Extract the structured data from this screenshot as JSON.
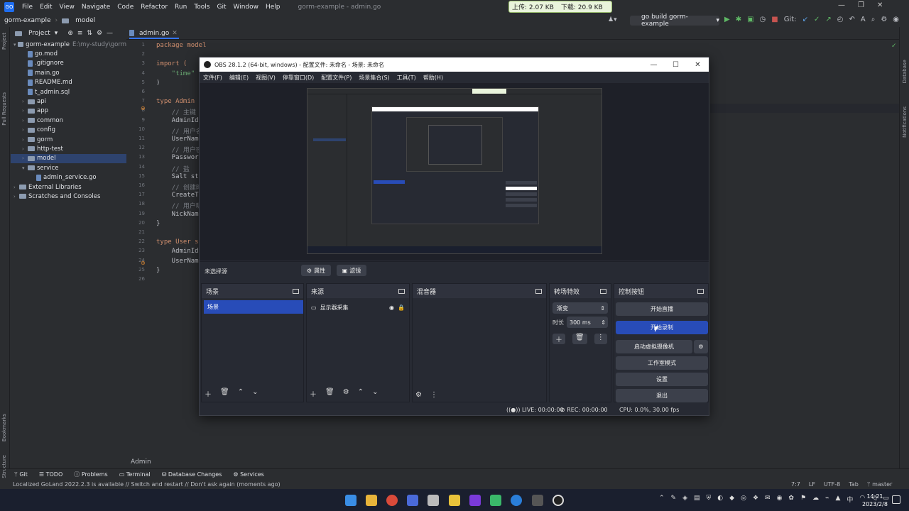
{
  "ide": {
    "menu": [
      "File",
      "Edit",
      "View",
      "Navigate",
      "Code",
      "Refactor",
      "Run",
      "Tools",
      "Git",
      "Window",
      "Help"
    ],
    "window_title": "gorm-example - admin.go",
    "breadcrumb": [
      "gorm-example",
      "model"
    ],
    "run_config": "go build gorm-example",
    "net_widget": {
      "up": "上传: 2.07 KB",
      "down": "下载: 20.9 KB"
    },
    "project_label": "Project",
    "tree": [
      {
        "label": "gorm-example",
        "suffix": "E:\\my-study\\gorm",
        "kind": "folder",
        "indent": 0,
        "open": true
      },
      {
        "label": "go.mod",
        "kind": "file",
        "indent": 1
      },
      {
        "label": ".gitignore",
        "kind": "file",
        "indent": 1
      },
      {
        "label": "main.go",
        "kind": "file",
        "indent": 1
      },
      {
        "label": "README.md",
        "kind": "file",
        "indent": 1
      },
      {
        "label": "t_admin.sql",
        "kind": "file",
        "indent": 1
      },
      {
        "label": "api",
        "kind": "folder",
        "indent": 1
      },
      {
        "label": "app",
        "kind": "folder",
        "indent": 1
      },
      {
        "label": "common",
        "kind": "folder",
        "indent": 1
      },
      {
        "label": "config",
        "kind": "folder",
        "indent": 1
      },
      {
        "label": "gorm",
        "kind": "folder",
        "indent": 1
      },
      {
        "label": "http-test",
        "kind": "folder",
        "indent": 1
      },
      {
        "label": "model",
        "kind": "folder",
        "indent": 1,
        "selected": true
      },
      {
        "label": "service",
        "kind": "folder",
        "indent": 1,
        "open": true
      },
      {
        "label": "admin_service.go",
        "kind": "file",
        "indent": 2
      },
      {
        "label": "External Libraries",
        "kind": "folder",
        "indent": 0
      },
      {
        "label": "Scratches and Consoles",
        "kind": "folder",
        "indent": 0
      }
    ],
    "editor_tab": "admin.go",
    "code_lines": [
      {
        "n": "1",
        "t": "package model",
        "c": "kw"
      },
      {
        "n": "2",
        "t": "",
        "c": ""
      },
      {
        "n": "3",
        "t": "import (",
        "c": "kw"
      },
      {
        "n": "4",
        "t": "    \"time\"",
        "c": "str"
      },
      {
        "n": "5",
        "t": ")",
        "c": ""
      },
      {
        "n": "6",
        "t": "",
        "c": ""
      },
      {
        "n": "7",
        "t": "type Admin",
        "c": "kw"
      },
      {
        "n": "8",
        "t": "    // 主键",
        "c": "cm"
      },
      {
        "n": "9",
        "t": "    AdminId",
        "c": ""
      },
      {
        "n": "10",
        "t": "    // 用户名",
        "c": "cm"
      },
      {
        "n": "11",
        "t": "    UserNam",
        "c": ""
      },
      {
        "n": "12",
        "t": "    // 用户密",
        "c": "cm"
      },
      {
        "n": "13",
        "t": "    Passwor",
        "c": ""
      },
      {
        "n": "14",
        "t": "    // 盐",
        "c": "cm"
      },
      {
        "n": "15",
        "t": "    Salt st",
        "c": ""
      },
      {
        "n": "16",
        "t": "    // 创建时",
        "c": "cm"
      },
      {
        "n": "17",
        "t": "    CreateT",
        "c": ""
      },
      {
        "n": "18",
        "t": "    // 用户昵",
        "c": "cm"
      },
      {
        "n": "19",
        "t": "    NickNam",
        "c": ""
      },
      {
        "n": "20",
        "t": "}",
        "c": ""
      },
      {
        "n": "21",
        "t": "",
        "c": ""
      },
      {
        "n": "22",
        "t": "type User s",
        "c": "kw"
      },
      {
        "n": "23",
        "t": "    AdminId",
        "c": ""
      },
      {
        "n": "24",
        "t": "    UserNam",
        "c": ""
      },
      {
        "n": "25",
        "t": "}",
        "c": ""
      },
      {
        "n": "26",
        "t": "",
        "c": ""
      }
    ],
    "editor_footer": "Admin",
    "bottom_tools": [
      "Git",
      "TODO",
      "Problems",
      "Terminal",
      "Database Changes",
      "Services"
    ],
    "status_message": "Localized GoLand 2022.2.3 is available // Switch and restart // Don't ask again (moments ago)",
    "status_right": [
      "7:7",
      "LF",
      "UTF-8",
      "Tab",
      "master"
    ],
    "left_vtabs": [
      "Project",
      "Pull Requests",
      "Bookmarks",
      "Structure"
    ],
    "right_vtabs": [
      "Database",
      "Notifications"
    ]
  },
  "obs": {
    "title": "OBS 28.1.2 (64-bit, windows) - 配置文件: 未命名 - 场景: 未命名",
    "menu": [
      "文件(F)",
      "编辑(E)",
      "视图(V)",
      "停靠窗口(D)",
      "配置文件(P)",
      "场景集合(S)",
      "工具(T)",
      "帮助(H)"
    ],
    "no_source": "未选择源",
    "properties_btn": "属性",
    "filters_btn": "滤镜",
    "docks": {
      "scenes": {
        "title": "场景",
        "items": [
          "场景"
        ]
      },
      "sources": {
        "title": "来源",
        "items": [
          "显示器采集"
        ]
      },
      "mixer": {
        "title": "混音器"
      },
      "transitions": {
        "title": "转场特效",
        "type": "渐变",
        "duration_label": "时长",
        "duration": "300 ms"
      },
      "controls": {
        "title": "控制按钮",
        "buttons": [
          "开始直播",
          "开始录制",
          "启动虚拟摄像机",
          "工作室模式",
          "设置",
          "退出"
        ]
      }
    },
    "status": {
      "live": "LIVE: 00:00:00",
      "rec": "REC: 00:00:00",
      "cpu": "CPU: 0.0%, 30.00 fps"
    }
  },
  "taskbar": {
    "time": "14:21",
    "date": "2023/2/8"
  },
  "colors": {
    "accent": "#284cb8",
    "ide_bg": "#2b2d30",
    "obs_bg": "#272a33"
  }
}
